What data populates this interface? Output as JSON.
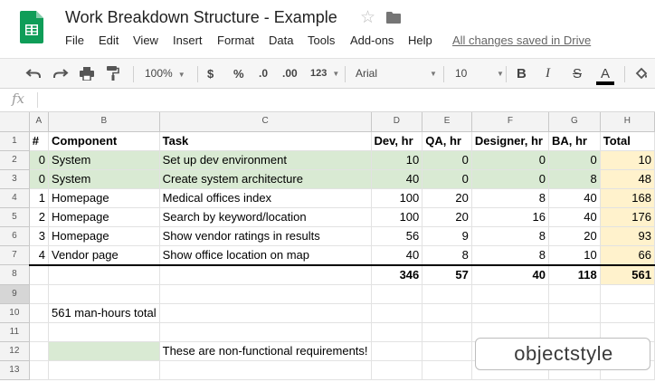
{
  "header": {
    "title": "Work Breakdown Structure - Example",
    "save_status": "All changes saved in Drive",
    "menu": [
      "File",
      "Edit",
      "View",
      "Insert",
      "Format",
      "Data",
      "Tools",
      "Add-ons",
      "Help"
    ]
  },
  "toolbar": {
    "zoom": "100%",
    "currency": "$",
    "percent": "%",
    "decrease_decimals": ".0",
    "increase_decimals": ".00",
    "more_formats": "123",
    "font": "Arial",
    "font_size": "10",
    "bold": "B",
    "italic": "I",
    "strikethrough": "S",
    "text_color": "A"
  },
  "formula_bar": {
    "label": "fx",
    "value": ""
  },
  "sheet": {
    "columns": [
      "A",
      "B",
      "C",
      "D",
      "E",
      "F",
      "G",
      "H"
    ],
    "rows": [
      {
        "n": "1",
        "cells": [
          "#",
          "Component",
          "Task",
          "Dev, hr",
          "QA, hr",
          "Designer, hr",
          "BA, hr",
          "Total"
        ]
      },
      {
        "n": "2",
        "cells": [
          "0",
          "System",
          "Set up dev environment",
          "10",
          "0",
          "0",
          "0",
          "10"
        ]
      },
      {
        "n": "3",
        "cells": [
          "0",
          "System",
          "Create system architecture",
          "40",
          "0",
          "0",
          "8",
          "48"
        ]
      },
      {
        "n": "4",
        "cells": [
          "1",
          "Homepage",
          "Medical offices index",
          "100",
          "20",
          "8",
          "40",
          "168"
        ]
      },
      {
        "n": "5",
        "cells": [
          "2",
          "Homepage",
          "Search by keyword/location",
          "100",
          "20",
          "16",
          "40",
          "176"
        ]
      },
      {
        "n": "6",
        "cells": [
          "3",
          "Homepage",
          "Show vendor ratings in results",
          "56",
          "9",
          "8",
          "20",
          "93"
        ]
      },
      {
        "n": "7",
        "cells": [
          "4",
          "Vendor page",
          "Show office location on map",
          "40",
          "8",
          "8",
          "10",
          "66"
        ]
      },
      {
        "n": "8",
        "cells": [
          "",
          "",
          "",
          "346",
          "57",
          "40",
          "118",
          "561"
        ]
      },
      {
        "n": "9",
        "cells": [
          "",
          "",
          "",
          "",
          "",
          "",
          "",
          ""
        ]
      },
      {
        "n": "10",
        "cells": [
          "",
          "561 man-hours total",
          "",
          "",
          "",
          "",
          "",
          ""
        ]
      },
      {
        "n": "11",
        "cells": [
          "",
          "",
          "",
          "",
          "",
          "",
          "",
          ""
        ]
      },
      {
        "n": "12",
        "cells": [
          "",
          "",
          "These are non-functional requirements!",
          "",
          "",
          "",
          "",
          ""
        ]
      },
      {
        "n": "13",
        "cells": [
          "",
          "",
          "",
          "",
          "",
          "",
          "",
          ""
        ]
      }
    ]
  },
  "brand": {
    "text": "objectstyle"
  },
  "colors": {
    "requirement_highlight": "#d9ead3",
    "total_highlight": "#fff2cc"
  }
}
